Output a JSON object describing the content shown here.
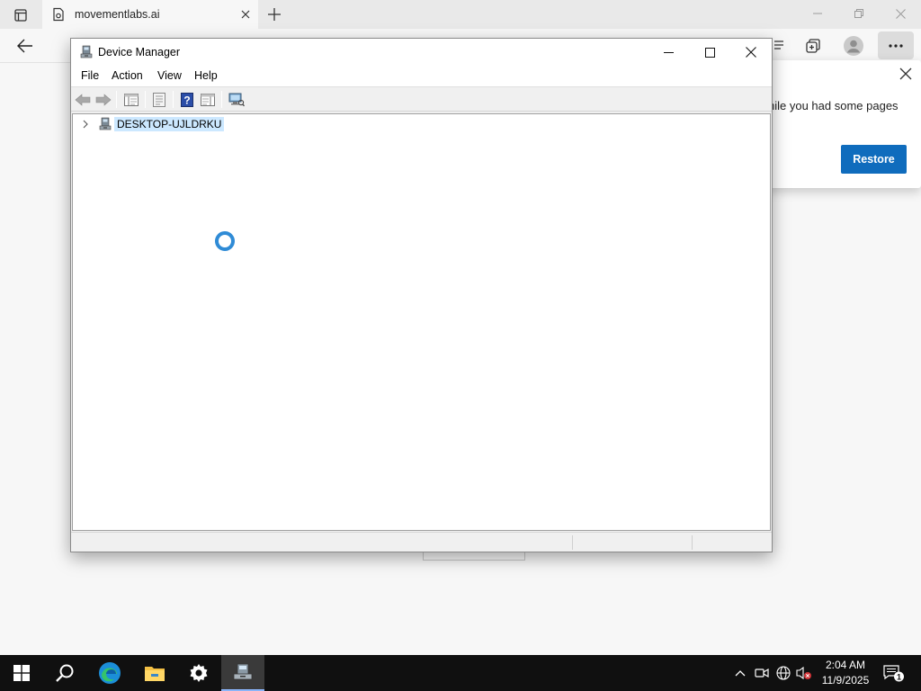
{
  "browser": {
    "tab_title": "movementlabs.ai",
    "restore_popup": {
      "message": "hile you had some pages",
      "restore_label": "Restore"
    }
  },
  "device_manager": {
    "title": "Device Manager",
    "menu": [
      "File",
      "Action",
      "View",
      "Help"
    ],
    "tree_root": "DESKTOP-UJLDRKU"
  },
  "taskbar": {
    "time": "2:04 AM",
    "date": "11/9/2025",
    "notification_count": "1"
  },
  "colors": {
    "accent": "#0f6cbd",
    "selection": "#cce8ff",
    "spinner": "#2f8bd6",
    "taskbar": "#101010"
  }
}
